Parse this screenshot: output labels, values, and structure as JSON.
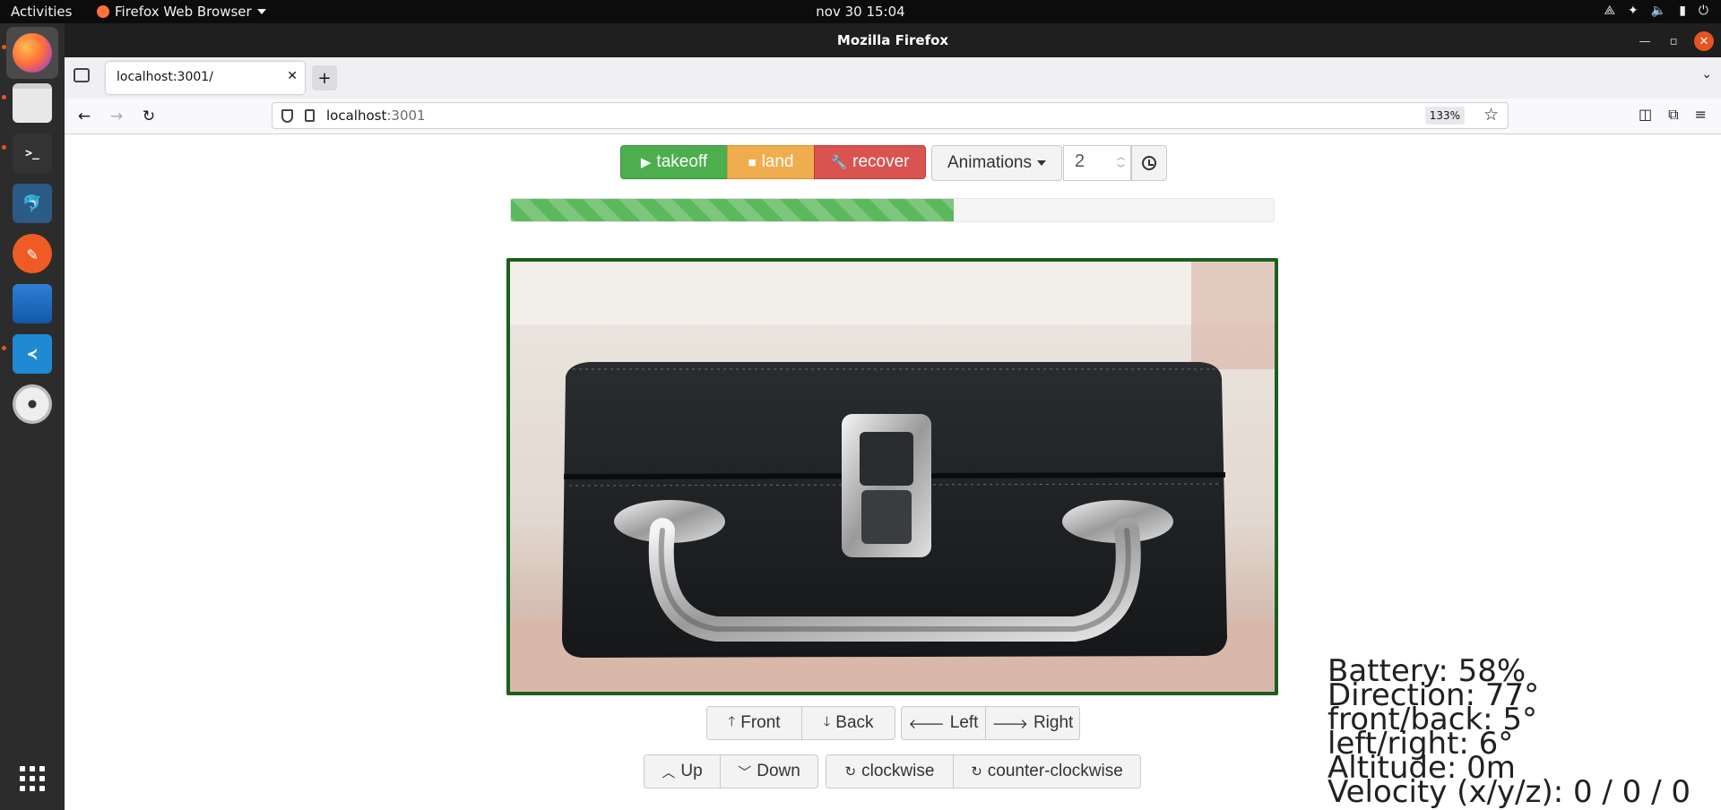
{
  "topbar": {
    "activities": "Activities",
    "app_menu": "Firefox Web Browser",
    "clock": "nov 30  15:04"
  },
  "dock": {
    "items": [
      {
        "name": "firefox",
        "active": true
      },
      {
        "name": "files"
      },
      {
        "name": "terminal"
      },
      {
        "name": "mysql-workbench"
      },
      {
        "name": "postman"
      },
      {
        "name": "wireshark"
      },
      {
        "name": "vscode"
      },
      {
        "name": "disc"
      }
    ]
  },
  "window": {
    "title": "Mozilla Firefox"
  },
  "tabs": [
    {
      "label": "localhost:3001/"
    }
  ],
  "urlbar": {
    "host": "localhost",
    "port": ":3001",
    "zoom": "133%"
  },
  "flight": {
    "takeoff": "takeoff",
    "land": "land",
    "recover": "recover",
    "animations": "Animations",
    "animation_value": "2"
  },
  "progress": {
    "fraction": 0.58
  },
  "movement": {
    "front": "Front",
    "back": "Back",
    "left": "Left",
    "right": "Right",
    "up": "Up",
    "down": "Down",
    "clockwise": "clockwise",
    "counter_clockwise": "counter-clockwise"
  },
  "telemetry": {
    "battery": "Battery: 58%",
    "direction": "Direction: 77°",
    "front_back": "front/back: 5°",
    "left_right": "left/right: 6°",
    "altitude": "Altitude: 0m",
    "velocity": "Velocity (x/y/z): 0 / 0 / 0"
  },
  "colors": {
    "takeoff": "#4cae4c",
    "land": "#f0ad4e",
    "recover": "#d9534f",
    "progress": "#5cb85c",
    "video_border": "#1b5e20",
    "ubuntu_orange": "#e95420"
  }
}
